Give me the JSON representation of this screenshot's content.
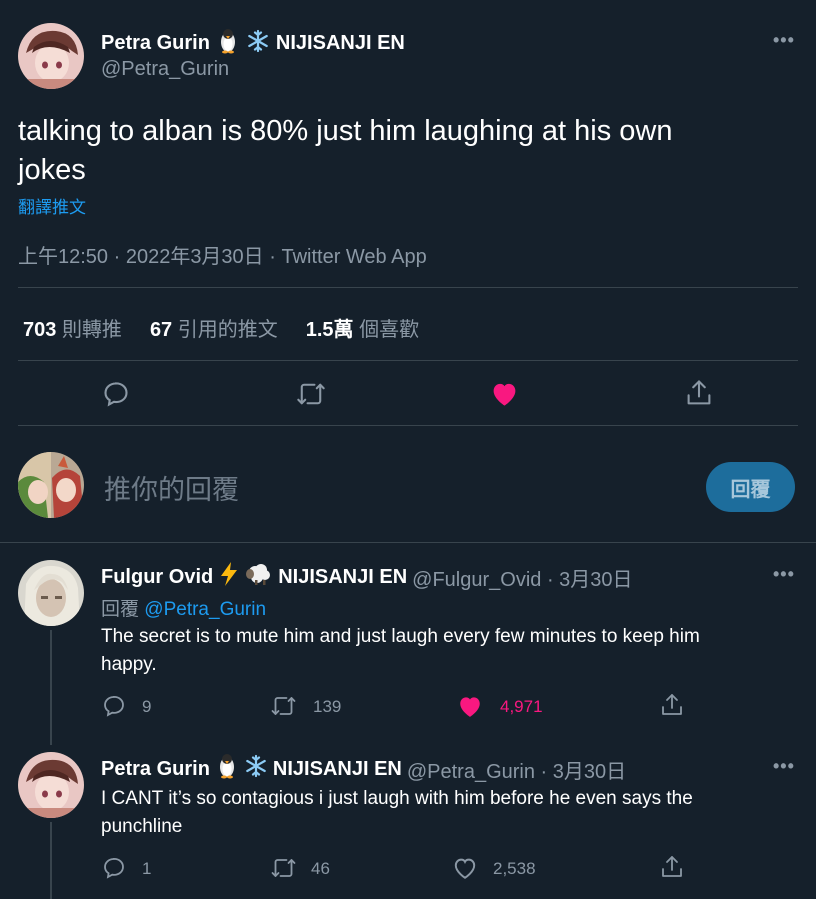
{
  "main_tweet": {
    "author_name": "Petra Gurin",
    "author_suffix": "NIJISANJI EN",
    "handle": "@Petra_Gurin",
    "text_line1": "talking to alban is 80% just him laughing at his own",
    "text_line2": "jokes",
    "translate": "翻譯推文",
    "meta": "上午12:50 · 2022年3月30日 · Twitter Web App",
    "stats": {
      "retweets_num": "703",
      "retweets_label": "則轉推",
      "quotes_num": "67",
      "quotes_label": "引用的推文",
      "likes_num": "1.5萬",
      "likes_label": "個喜歡"
    }
  },
  "composer": {
    "placeholder": "推你的回覆",
    "button": "回覆"
  },
  "replies": [
    {
      "author_name": "Fulgur Ovid",
      "author_suffix": "NIJISANJI EN",
      "handle_date": "@Fulgur_Ovid · 3月30日",
      "replying_prefix": "回覆",
      "replying_to": "@Petra_Gurin",
      "text_line1": "The secret is to mute him and just laugh every few minutes to keep him",
      "text_line2": "happy.",
      "replies": "9",
      "retweets": "139",
      "likes": "4,971"
    },
    {
      "author_name": "Petra Gurin",
      "author_suffix": "NIJISANJI EN",
      "handle_date": "@Petra_Gurin · 3月30日",
      "text_line1": "I CANT it’s so contagious i just laugh with him before he even says the",
      "text_line2": "punchline",
      "replies": "1",
      "retweets": "46",
      "likes": "2,538"
    }
  ],
  "colors": {
    "background": "#15202b",
    "accent": "#1d9bf0",
    "like_pink": "#f91880",
    "muted": "#8b98a5"
  }
}
